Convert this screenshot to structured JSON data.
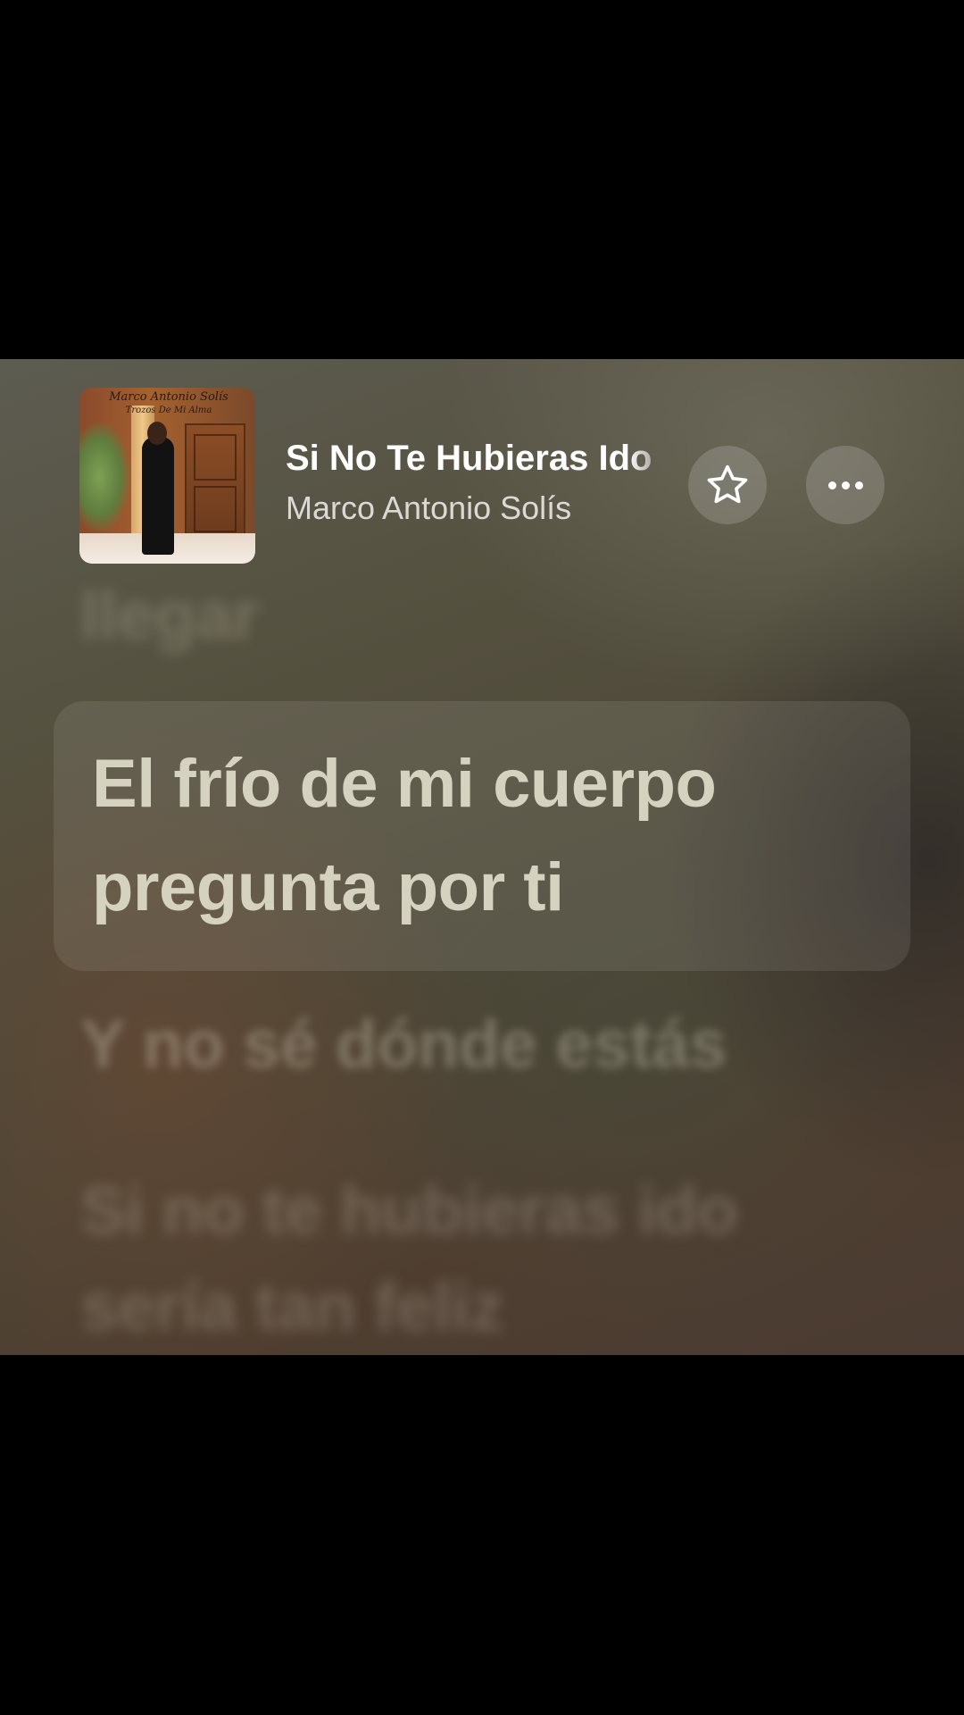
{
  "now_playing": {
    "title": "Si No Te Hubieras Ido",
    "artist": "Marco Antonio Solís",
    "album_art": {
      "artist_text": "Marco Antonio Solís",
      "album_text": "Trozos De Mi Alma"
    },
    "favorite_icon": "star-outline-icon",
    "more_icon": "ellipsis-icon"
  },
  "lyrics": {
    "previous": "llegar",
    "current": [
      "El frío de mi cuerpo",
      "pregunta por ti"
    ],
    "next": "Y no sé dónde estás",
    "upcoming": [
      "Si no te hubieras ido",
      "sería tan feliz"
    ]
  },
  "colors": {
    "background": "#000000",
    "panel_mid": "#4d4838",
    "active_lyric": "#d6d2c0"
  }
}
